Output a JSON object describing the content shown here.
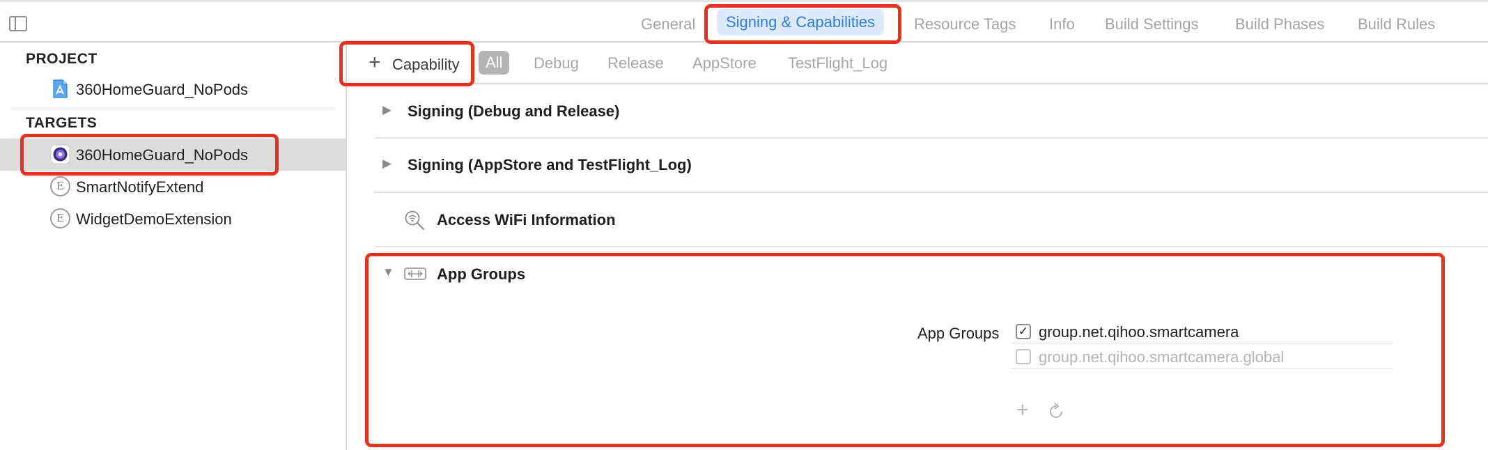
{
  "tabs": [
    {
      "label": "General",
      "active": false
    },
    {
      "label": "Signing & Capabilities",
      "active": true
    },
    {
      "label": "Resource Tags",
      "active": false
    },
    {
      "label": "Info",
      "active": false
    },
    {
      "label": "Build Settings",
      "active": false
    },
    {
      "label": "Build Phases",
      "active": false
    },
    {
      "label": "Build Rules",
      "active": false
    }
  ],
  "sidebar": {
    "project_heading": "PROJECT",
    "project_item": {
      "label": "360HomeGuard_NoPods",
      "icon": "project-file-icon"
    },
    "targets_heading": "TARGETS",
    "targets": [
      {
        "label": "360HomeGuard_NoPods",
        "icon": "app-target-icon",
        "selected": true
      },
      {
        "label": "SmartNotifyExtend",
        "icon": "extension-icon",
        "glyph": "E"
      },
      {
        "label": "WidgetDemoExtension",
        "icon": "extension-icon",
        "glyph": "E"
      }
    ]
  },
  "filterbar": {
    "capability_button": "Capability",
    "filters": [
      {
        "label": "All",
        "active": true
      },
      {
        "label": "Debug",
        "active": false
      },
      {
        "label": "Release",
        "active": false
      },
      {
        "label": "AppStore",
        "active": false
      },
      {
        "label": "TestFlight_Log",
        "active": false
      }
    ]
  },
  "capabilities": {
    "signing_debug_release": "Signing (Debug and Release)",
    "signing_appstore": "Signing (AppStore and TestFlight_Log)",
    "access_wifi": "Access WiFi Information",
    "app_groups": {
      "title": "App Groups",
      "field_label": "App Groups",
      "groups": [
        {
          "id": "group.net.qihoo.smartcamera",
          "checked": true
        },
        {
          "id": "group.net.qihoo.smartcamera.global",
          "checked": false
        }
      ],
      "add_icon": "plus-icon",
      "refresh_icon": "refresh-icon"
    }
  },
  "colors": {
    "accent": "#2f7de1",
    "active_tab_bg": "#dceafb",
    "highlight_border": "#e5321f",
    "selected_row": "#dcdcdc"
  }
}
